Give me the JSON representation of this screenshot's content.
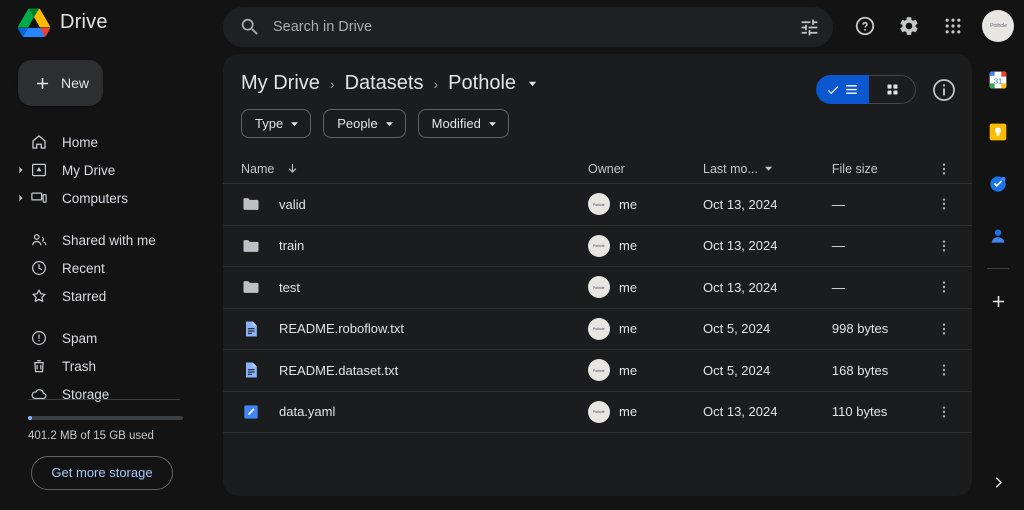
{
  "app": {
    "brand_name": "Drive",
    "logo_icon": "google-drive-logo"
  },
  "search": {
    "placeholder": "Search in Drive",
    "value": "",
    "search_icon": "search-icon",
    "tune_icon": "tune-filter-icon"
  },
  "top_actions": {
    "help_icon": "help-circle-icon",
    "settings_icon": "gear-icon",
    "apps_icon": "apps-grid-icon",
    "avatar_label": "Pothole",
    "avatar_icon": "user-avatar"
  },
  "sidebar": {
    "new_button": {
      "label": "New",
      "icon": "plus-icon"
    },
    "items": [
      {
        "label": "Home",
        "icon": "home-icon",
        "expandable": false
      },
      {
        "label": "My Drive",
        "icon": "my-drive-icon",
        "expandable": true
      },
      {
        "label": "Computers",
        "icon": "computers-icon",
        "expandable": true
      },
      {
        "label": "Shared with me",
        "icon": "people-icon",
        "expandable": false
      },
      {
        "label": "Recent",
        "icon": "clock-icon",
        "expandable": false
      },
      {
        "label": "Starred",
        "icon": "star-icon",
        "expandable": false
      },
      {
        "label": "Spam",
        "icon": "exclamation-circle-icon",
        "expandable": false
      },
      {
        "label": "Trash",
        "icon": "trash-icon",
        "expandable": false
      },
      {
        "label": "Storage",
        "icon": "cloud-icon",
        "expandable": false
      }
    ],
    "storage": {
      "used_text": "401.2 MB of 15 GB used",
      "used_percent": 2.6,
      "get_more_label": "Get more storage"
    }
  },
  "breadcrumb": {
    "items": [
      "My Drive",
      "Datasets",
      "Pothole"
    ],
    "separator": "›",
    "caret_icon": "chevron-down-icon"
  },
  "view_toggle": {
    "list_active": true,
    "list_icon": "list-view-icon",
    "check_icon": "check-icon",
    "grid_icon": "grid-view-icon",
    "info_icon": "info-circle-icon",
    "active_color": "#0b57d0"
  },
  "filters": [
    {
      "label": "Type",
      "icon": "chevron-down-icon"
    },
    {
      "label": "People",
      "icon": "chevron-down-icon"
    },
    {
      "label": "Modified",
      "icon": "chevron-down-icon"
    }
  ],
  "table": {
    "columns": {
      "name": "Name",
      "owner": "Owner",
      "modified": "Last mo...",
      "size": "File size"
    },
    "sort_icon": "arrow-down-icon",
    "modified_caret": "caret-down-icon",
    "more_icon": "more-vertical-icon",
    "rows": [
      {
        "name": "valid",
        "icon": "folder-icon",
        "owner": "me",
        "modified": "Oct 13, 2024",
        "size": "—"
      },
      {
        "name": "train",
        "icon": "folder-icon",
        "owner": "me",
        "modified": "Oct 13, 2024",
        "size": "—"
      },
      {
        "name": "test",
        "icon": "folder-icon",
        "owner": "me",
        "modified": "Oct 13, 2024",
        "size": "—"
      },
      {
        "name": "README.roboflow.txt",
        "icon": "text-file-icon",
        "owner": "me",
        "modified": "Oct 5, 2024",
        "size": "998 bytes"
      },
      {
        "name": "README.dataset.txt",
        "icon": "text-file-icon",
        "owner": "me",
        "modified": "Oct 5, 2024",
        "size": "168 bytes"
      },
      {
        "name": "data.yaml",
        "icon": "yaml-file-icon",
        "owner": "me",
        "modified": "Oct 13, 2024",
        "size": "110 bytes"
      }
    ]
  },
  "right_rail": {
    "items": [
      {
        "name": "google-calendar-icon"
      },
      {
        "name": "google-keep-icon"
      },
      {
        "name": "google-tasks-icon"
      },
      {
        "name": "google-contacts-icon"
      }
    ],
    "add_icon": "plus-icon",
    "expand_icon": "chevron-right-icon"
  }
}
